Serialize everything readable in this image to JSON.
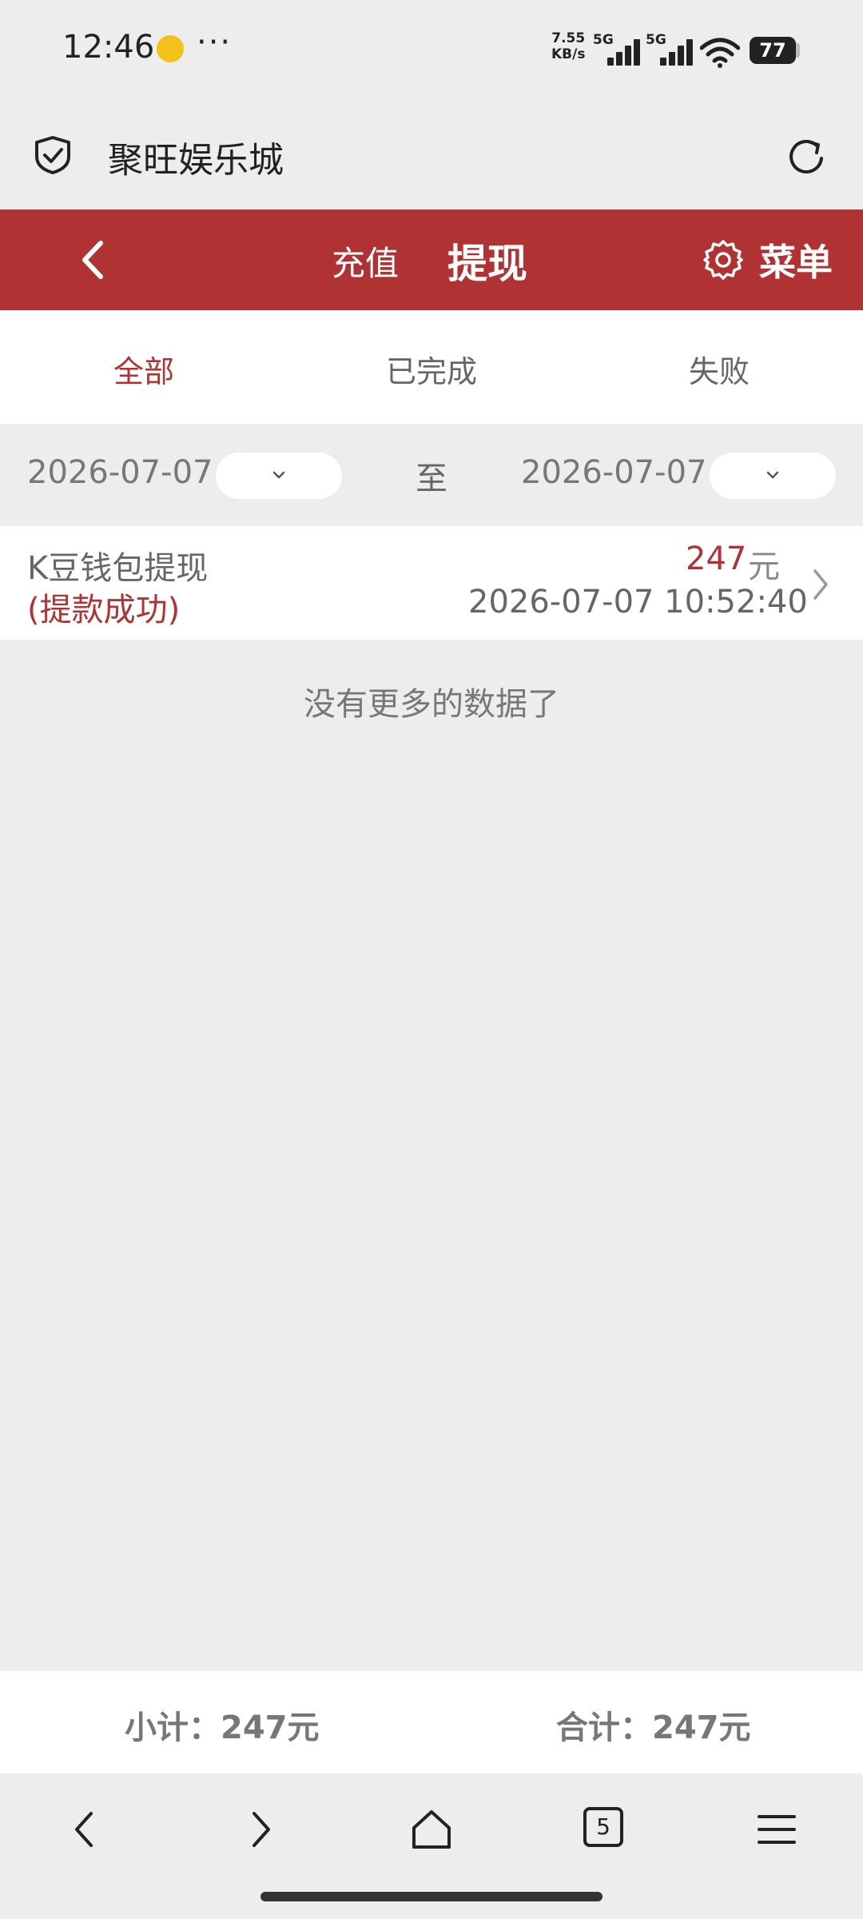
{
  "status_bar": {
    "time": "12:46",
    "dots": "···",
    "net_speed_value": "7.55",
    "net_speed_unit": "KB/s",
    "sim1_label": "5G",
    "sim2_label": "5G",
    "battery": "77",
    "icons": [
      "notification-emoji-icon",
      "signal-icon",
      "wifi-icon",
      "battery-icon"
    ]
  },
  "browser": {
    "site_title": "聚旺娱乐城",
    "icons": [
      "shield-check-icon",
      "refresh-icon"
    ]
  },
  "header": {
    "back_icon": "chevron-left-icon",
    "tabs": [
      {
        "label": "充值"
      },
      {
        "label": "提现",
        "active": true
      }
    ],
    "menu_label": "菜单",
    "menu_icon": "gear-icon",
    "color": "#b03233"
  },
  "filter_tabs": [
    {
      "label": "全部",
      "active": true
    },
    {
      "label": "已完成"
    },
    {
      "label": "失败"
    }
  ],
  "date_range": {
    "from": "2026-07-07",
    "to_label": "至",
    "to": "2026-07-07"
  },
  "records": [
    {
      "title": "K豆钱包提现",
      "status": "(提款成功)",
      "amount": "247",
      "unit": "元",
      "time": "2026-07-07 10:52:40"
    }
  ],
  "no_more_text": "没有更多的数据了",
  "totals": {
    "subtotal": "小计：247元",
    "total": "合计：247元"
  },
  "nav": {
    "tab_count": "5",
    "icons": [
      "back-icon",
      "forward-icon",
      "home-icon",
      "tabs-icon",
      "menu-icon"
    ]
  }
}
